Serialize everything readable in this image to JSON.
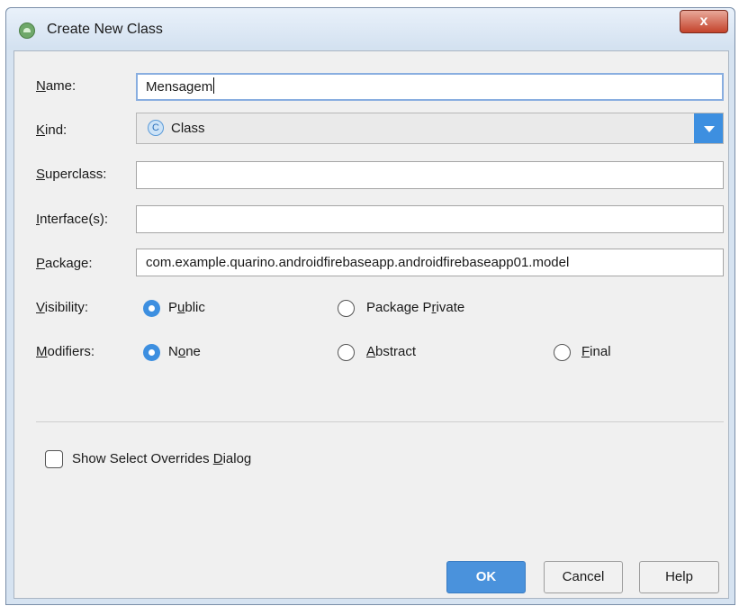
{
  "window": {
    "title": "Create New Class",
    "close_label": "x"
  },
  "form": {
    "name": {
      "label_pre": "",
      "label_key": "N",
      "label_post": "ame:",
      "value": "Mensagem"
    },
    "kind": {
      "label_pre": "",
      "label_key": "K",
      "label_post": "ind:",
      "value": "Class",
      "icon": "class-icon",
      "icon_glyph": "C"
    },
    "superclass": {
      "label_pre": "",
      "label_key": "S",
      "label_post": "uperclass:",
      "value": ""
    },
    "interfaces": {
      "label_pre": "",
      "label_key": "I",
      "label_post": "nterface(s):",
      "value": ""
    },
    "package": {
      "label_pre": "",
      "label_key": "P",
      "label_post": "ackage:",
      "value": "com.example.quarino.androidfirebaseapp.androidfirebaseapp01.model"
    },
    "visibility": {
      "label_pre": "",
      "label_key": "V",
      "label_post": "isibility:",
      "options": [
        {
          "pre": "P",
          "key": "u",
          "post": "blic",
          "checked": true
        },
        {
          "pre": "Package P",
          "key": "r",
          "post": "ivate",
          "checked": false
        }
      ]
    },
    "modifiers": {
      "label_pre": "",
      "label_key": "M",
      "label_post": "odifiers:",
      "options": [
        {
          "pre": "N",
          "key": "o",
          "post": "ne",
          "checked": true
        },
        {
          "pre": "",
          "key": "A",
          "post": "bstract",
          "checked": false
        },
        {
          "pre": "",
          "key": "F",
          "post": "inal",
          "checked": false
        }
      ]
    },
    "show_overrides": {
      "pre": "Show Select Overrides ",
      "key": "D",
      "post": "ialog",
      "checked": false
    }
  },
  "buttons": {
    "ok": "OK",
    "cancel": "Cancel",
    "help": "Help"
  },
  "colors": {
    "accent": "#3d8fe0",
    "title_bar": "#d6e3f1",
    "close_button": "#c4432b"
  }
}
